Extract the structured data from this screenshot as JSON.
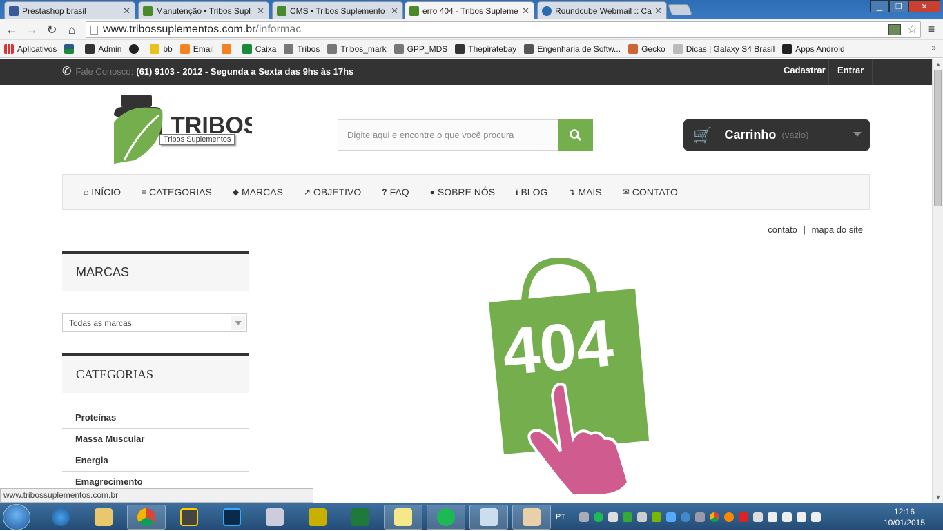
{
  "browser": {
    "tabs": [
      {
        "title": "Prestashop brasil",
        "color": "#3b5998"
      },
      {
        "title": "Manutenção • Tribos Supl",
        "color": "#4a8a2a"
      },
      {
        "title": "CMS • Tribos Suplemento",
        "color": "#4a8a2a"
      },
      {
        "title": "erro 404 - Tribos Supleme",
        "color": "#4a8a2a"
      },
      {
        "title": "Roundcube Webmail :: Ca",
        "color": "#2a6ab0"
      }
    ],
    "address_host": "www.tribossuplementos.com.br",
    "address_path": "/informac",
    "bookmarks": [
      {
        "label": "Aplicativos",
        "color": "#d33"
      },
      {
        "label": "",
        "color": "#2a5a8a"
      },
      {
        "label": "Admin",
        "color": "#333"
      },
      {
        "label": "",
        "color": "#222"
      },
      {
        "label": "bb",
        "color": "#e8c21a"
      },
      {
        "label": "Email",
        "color": "#f58220"
      },
      {
        "label": "",
        "color": "#f58220"
      },
      {
        "label": "Caixa",
        "color": "#1a8a3a"
      },
      {
        "label": "Tribos",
        "color": "#666"
      },
      {
        "label": "Tribos_mark",
        "color": "#666"
      },
      {
        "label": "GPP_MDS",
        "color": "#666"
      },
      {
        "label": "Thepiratebay",
        "color": "#333"
      },
      {
        "label": "Engenharia de Softw...",
        "color": "#555"
      },
      {
        "label": "Gecko",
        "color": "#c63"
      },
      {
        "label": "Dicas | Galaxy S4 Brasil",
        "color": "#888"
      },
      {
        "label": "Apps Android",
        "color": "#222"
      }
    ],
    "status_url": "www.tribossuplementos.com.br"
  },
  "site": {
    "phone_label": "Fale Conosco:",
    "phone_text": "(61) 9103 - 2012 - Segunda a Sexta das 9hs às 17hs",
    "register": "Cadastrar",
    "login": "Entrar",
    "logo_text": "TRIBOS",
    "logo_tagline": "Tribos Suplementos",
    "search_placeholder": "Digite aqui e encontre o que você procura",
    "cart_label": "Carrinho",
    "cart_status": "(vazio)",
    "menu": [
      "INÍCIO",
      "CATEGORIAS",
      "MARCAS",
      "OBJETIVO",
      "FAQ",
      "SOBRE NÓS",
      "BLOG",
      "MAIS",
      "CONTATO"
    ],
    "menu_icons": [
      "⌂",
      "≡",
      "◆",
      "↗",
      "?",
      "●",
      "i",
      "↴",
      "✉"
    ],
    "contact_link": "contato",
    "separator": "|",
    "sitemap_link": "mapa do site",
    "brands_title": "MARCAS",
    "brands_select": "Todas as marcas",
    "categories_title": "CATEGORIAS",
    "categories": [
      "Proteínas",
      "Massa Muscular",
      "Energia",
      "Emagrecimento"
    ],
    "error_code": "404",
    "colors": {
      "brand_green": "#74ae4d",
      "dark": "#333333",
      "pink": "#d05b8f"
    }
  },
  "taskbar": {
    "language": "PT",
    "time": "12:16",
    "date": "10/01/2015"
  }
}
